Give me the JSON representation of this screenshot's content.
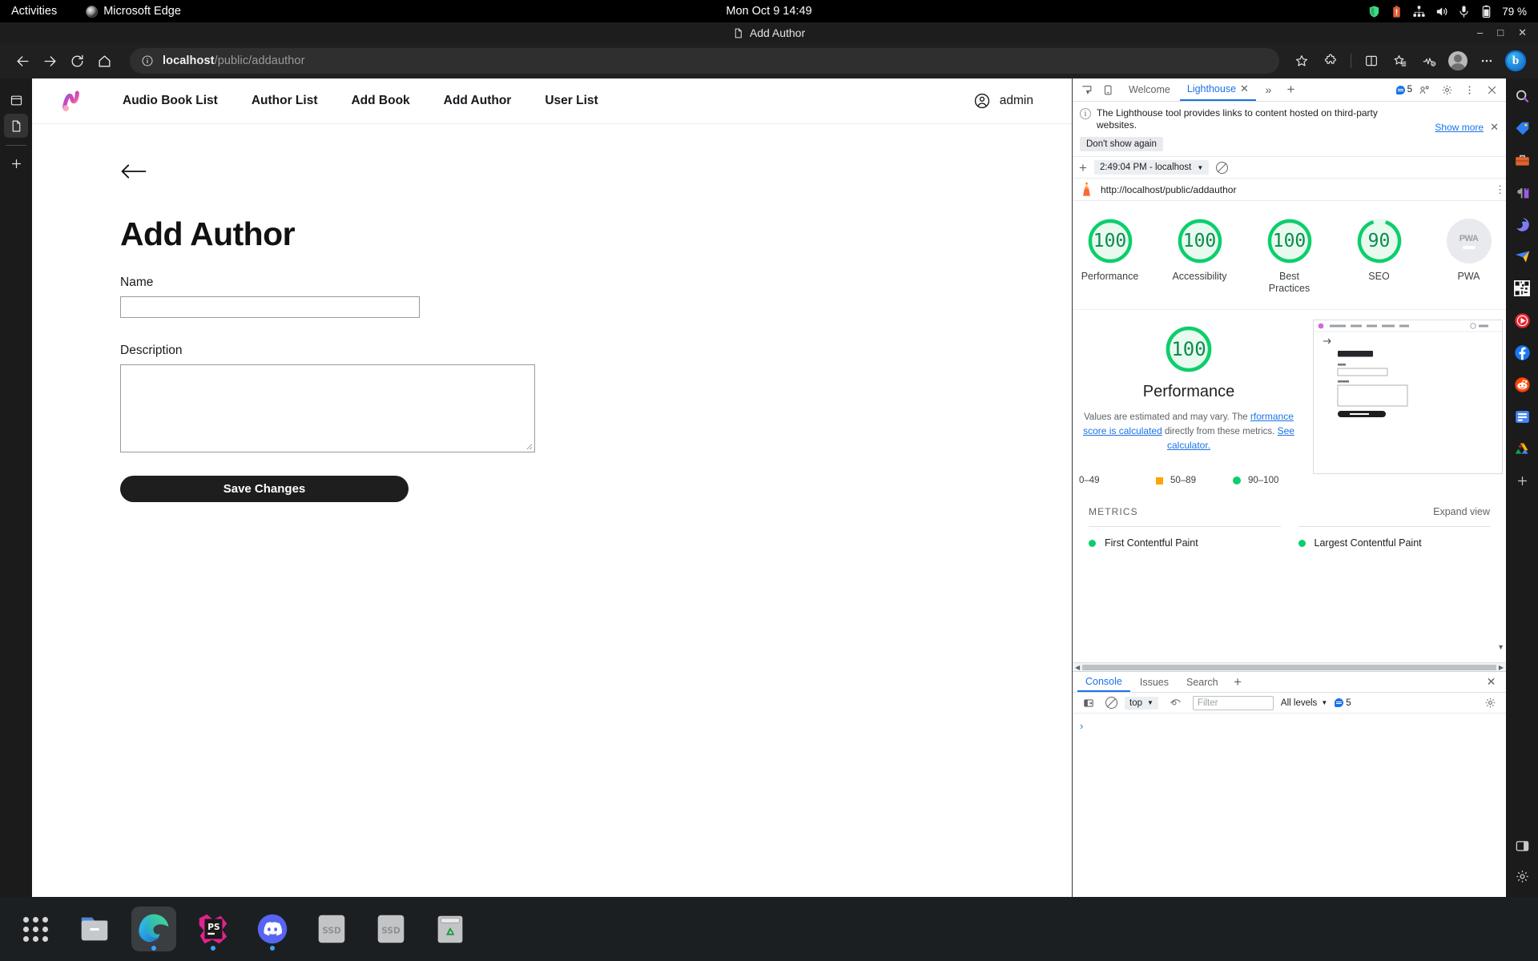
{
  "os": {
    "activities": "Activities",
    "app_name": "Microsoft Edge",
    "clock": "Mon Oct 9  14:49",
    "battery": "79 %",
    "tray_icons": [
      "shield-icon",
      "battery-alert-icon",
      "network-icon",
      "volume-icon",
      "microphone-icon",
      "battery-icon"
    ]
  },
  "window": {
    "title": "Add Author",
    "minimize": "–",
    "maximize": "□",
    "close": "✕"
  },
  "browser": {
    "back": "←",
    "forward": "→",
    "reload": "⟳",
    "home": "⌂",
    "url_host": "localhost",
    "url_path": "/public/addauthor",
    "site_info_icon": "info-circle-icon",
    "right_icons": [
      "favorite-star-icon",
      "extensions-puzzle-icon",
      "split-screen-icon",
      "collections-icon",
      "browser-essentials-icon",
      "profile-avatar-icon",
      "settings-more-icon",
      "copilot-bing-icon"
    ],
    "bing_glyph": "b"
  },
  "edge_rail": {
    "items": [
      {
        "name": "browser-essentials-panel",
        "icon": "panel-icon"
      },
      {
        "name": "document-panel",
        "icon": "document-icon",
        "active": true
      },
      {
        "name": "add-panel",
        "icon": "plus-icon"
      }
    ]
  },
  "site": {
    "logo_alt": "app-logo",
    "nav": [
      {
        "label": "Audio Book List",
        "name": "nav-audio-book-list"
      },
      {
        "label": "Author List",
        "name": "nav-author-list"
      },
      {
        "label": "Add Book",
        "name": "nav-add-book"
      },
      {
        "label": "Add Author",
        "name": "nav-add-author"
      },
      {
        "label": "User List",
        "name": "nav-user-list"
      }
    ],
    "user": "admin"
  },
  "form": {
    "back_arrow": "←",
    "title": "Add Author",
    "name_label": "Name",
    "name_value": "",
    "name_placeholder": "",
    "description_label": "Description",
    "description_value": "",
    "description_placeholder": "",
    "submit_label": "Save Changes"
  },
  "devtools": {
    "tabs": [
      {
        "label": "Welcome",
        "active": false
      },
      {
        "label": "Lighthouse",
        "active": true,
        "closeable": true
      }
    ],
    "more_tabs": "»",
    "new_tab": "+",
    "issue_count": "5",
    "banner": {
      "text": "The Lighthouse tool provides links to content hosted on third-party websites.",
      "show_more": "Show more",
      "dont_show_again": "Don't show again",
      "close": "✕"
    },
    "run_selector": "2:49:04 PM - localhost",
    "audited_url": "http://localhost/public/addauthor",
    "gauges": [
      {
        "label": "Performance",
        "score": "100",
        "state": "pass"
      },
      {
        "label": "Accessibility",
        "score": "100",
        "state": "pass"
      },
      {
        "label": "Best Practices",
        "score": "100",
        "state": "pass"
      },
      {
        "label": "SEO",
        "score": "90",
        "state": "pass"
      },
      {
        "label": "PWA",
        "score": "PWA",
        "state": "na"
      }
    ],
    "performance": {
      "score": "100",
      "title": "Performance",
      "desc_1": "Values are estimated and may vary. The ",
      "desc_link": "rformance score is calculated",
      "desc_2": " directly from these metrics. ",
      "desc_link2": "See calculator.",
      "legend": [
        "0–49",
        "50–89",
        "90–100"
      ]
    },
    "metrics": {
      "heading": "METRICS",
      "expand": "Expand view",
      "items": [
        {
          "name": "First Contentful Paint",
          "state": "pass"
        },
        {
          "name": "Largest Contentful Paint",
          "state": "pass"
        }
      ]
    },
    "drawer": {
      "tabs": [
        {
          "label": "Console",
          "active": true
        },
        {
          "label": "Issues",
          "active": false
        },
        {
          "label": "Search",
          "active": false
        }
      ],
      "new_tab": "+",
      "close": "✕",
      "context": "top",
      "filter_placeholder": "Filter",
      "levels": "All levels",
      "message_count": "5",
      "prompt": "›"
    }
  },
  "right_rail": {
    "icons": [
      "search-icon",
      "price-tag-icon",
      "shopping-bag-icon",
      "games-icon",
      "copilot-icon",
      "send-icon",
      "qr-code-icon",
      "youtube-icon",
      "facebook-icon",
      "reddit-icon",
      "notes-icon",
      "google-drive-icon",
      "add-sidebar-icon"
    ],
    "bottom_icons": [
      "dual-pane-icon",
      "sidebar-settings-icon"
    ]
  },
  "taskbar": {
    "items": [
      {
        "name": "show-apps-button",
        "icon": "grid-icon"
      },
      {
        "name": "files-app",
        "icon": "folder-icon"
      },
      {
        "name": "microsoft-edge-app",
        "icon": "edge-icon",
        "active": true,
        "running": true
      },
      {
        "name": "phpstorm-app",
        "icon": "phpstorm-icon",
        "running": true,
        "label": "PS"
      },
      {
        "name": "discord-app",
        "icon": "discord-icon",
        "running": true
      },
      {
        "name": "ssd-drive-1",
        "icon": "drive-icon",
        "label": "SSD"
      },
      {
        "name": "ssd-drive-2",
        "icon": "drive-icon",
        "label": "SSD"
      },
      {
        "name": "trash",
        "icon": "trash-icon"
      }
    ]
  },
  "colors": {
    "pass_green": "#0cce6b",
    "gauge_text_green": "#0c8b4b",
    "average_orange": "#ffa400",
    "link_blue": "#1a73e8",
    "dark_button": "#1e1e1e"
  }
}
